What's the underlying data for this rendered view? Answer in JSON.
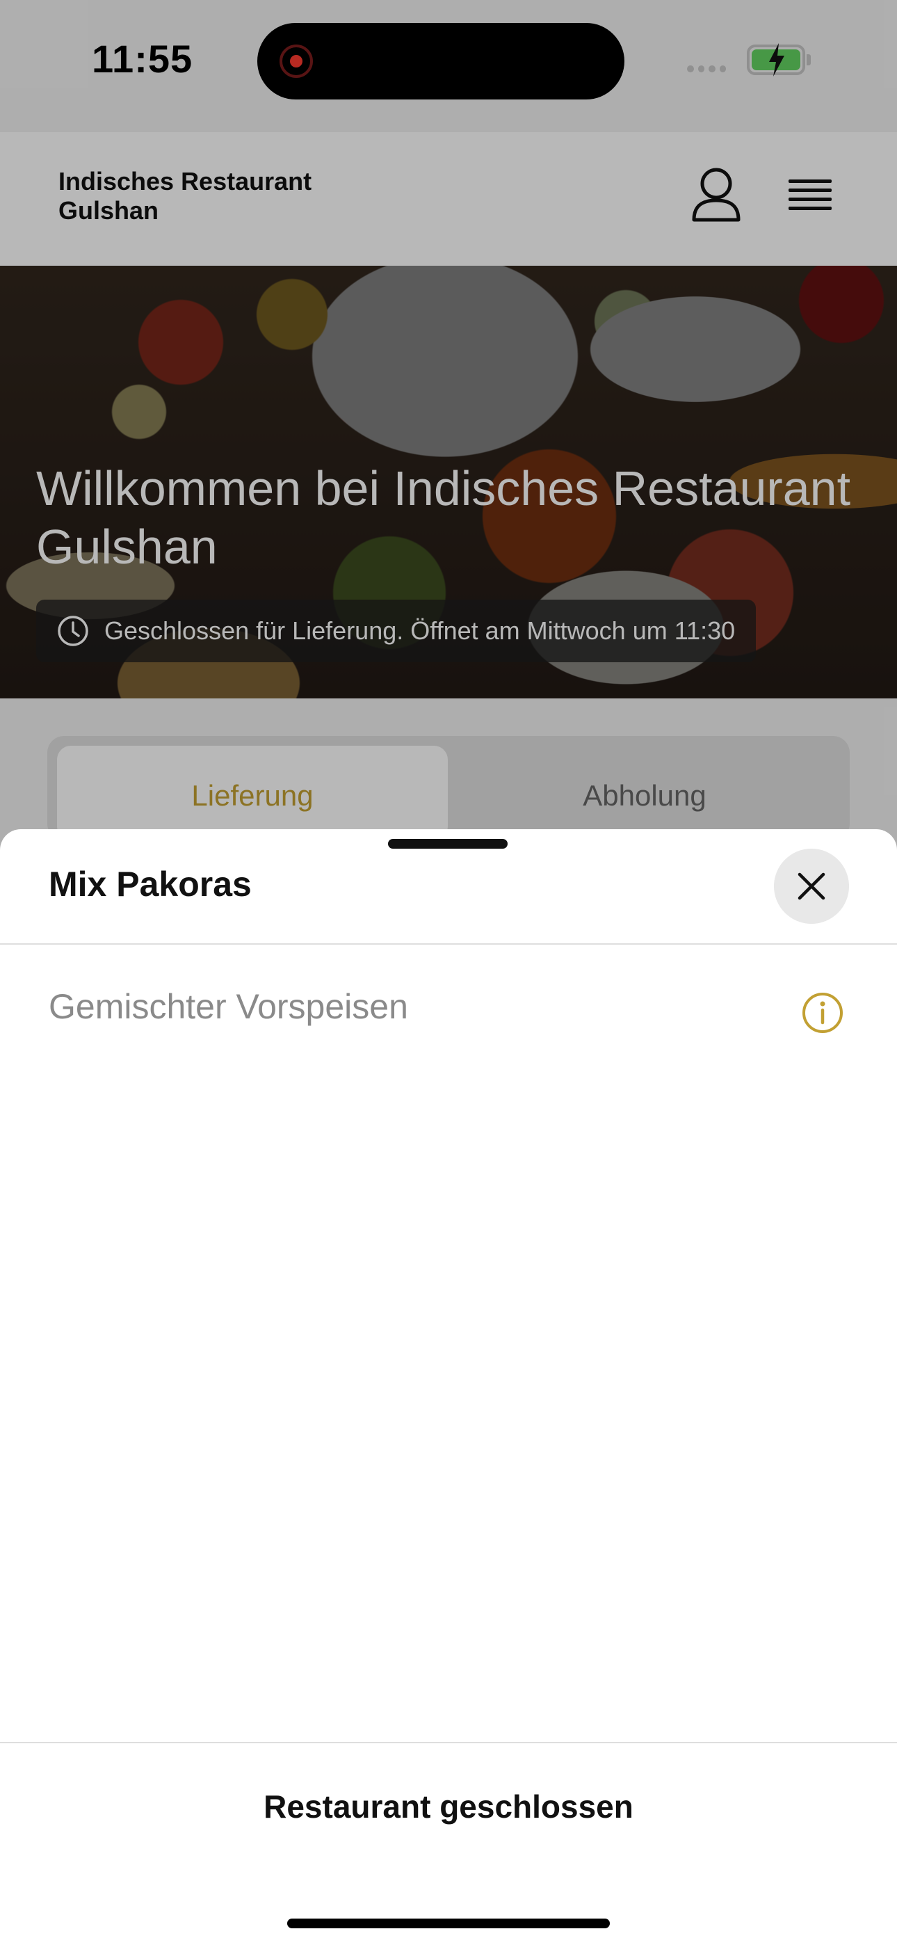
{
  "status_bar": {
    "time": "11:55",
    "recording_indicator_icon": "record-dot-icon",
    "battery_icon": "battery-charging-icon",
    "battery_color": "#63d362"
  },
  "header": {
    "brand": "Indisches Restaurant Gulshan",
    "account_icon": "user-icon",
    "menu_icon": "hamburger-menu-icon"
  },
  "hero": {
    "title": "Willkommen bei Indisches Restaurant Gulshan",
    "status_icon": "clock-icon",
    "status_text": "Geschlossen für Lieferung. Öffnet am Mittwoch um 11:30"
  },
  "tabs": {
    "delivery": "Lieferung",
    "pickup": "Abholung",
    "selected": "Lieferung"
  },
  "sheet": {
    "title": "Mix Pakoras",
    "close_icon": "close-icon",
    "description": "Gemischter Vorspeisen",
    "info_icon": "info-icon",
    "bottom_action": "Restaurant geschlossen"
  },
  "colors": {
    "accent_gold": "#c2a033",
    "text_primary": "#111111",
    "text_muted": "#8a8a8a"
  }
}
